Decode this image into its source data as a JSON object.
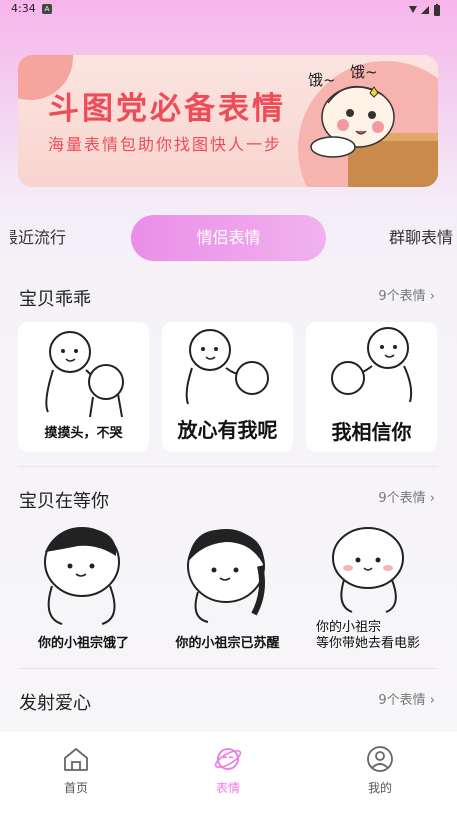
{
  "status": {
    "time": "4:34",
    "a_label": "A"
  },
  "banner": {
    "title": "斗图党必备表情",
    "subtitle": "海量表情包助你找图快人一步",
    "bubble_left": "饿~",
    "bubble_right": "饿~"
  },
  "tabs": [
    {
      "label": "最近流行"
    },
    {
      "label": "情侣表情"
    },
    {
      "label": "群聊表情"
    }
  ],
  "sections": [
    {
      "title": "宝贝乖乖",
      "more": "9个表情",
      "captions": [
        "摸摸头，不哭",
        "放心有我呢",
        "我相信你"
      ]
    },
    {
      "title": "宝贝在等你",
      "more": "9个表情",
      "captions": [
        "你的小祖宗饿了",
        "你的小祖宗已苏醒",
        "你的小祖宗\n等你带她去看电影"
      ]
    },
    {
      "title": "发射爱心",
      "more": "9个表情"
    }
  ],
  "nav": {
    "home": "首页",
    "emoji": "表情",
    "mine": "我的",
    "active_color": "#ef7ae3"
  },
  "colors": {
    "accent": "#ea8ee8",
    "banner_text": "#ee4c56"
  }
}
